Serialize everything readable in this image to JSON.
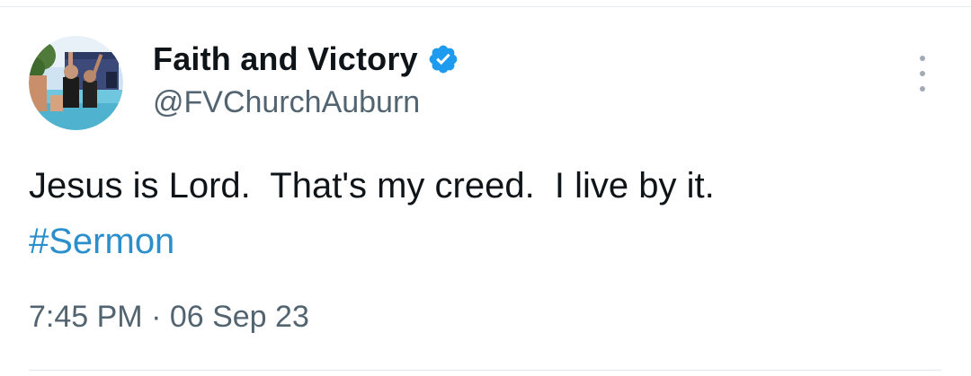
{
  "author": {
    "display_name": "Faith and Victory",
    "handle": "@FVChurchAuburn",
    "verified": true,
    "verified_icon": "verified-badge-icon",
    "verified_color": "#1d9bf0"
  },
  "tweet": {
    "text": "Jesus is Lord.  That's my creed.  I live by it.",
    "hashtag": "#Sermon",
    "timestamp": "7:45 PM · 06 Sep 23"
  },
  "menu": {
    "icon": "more-vertical-icon"
  },
  "colors": {
    "text_primary": "#0f1419",
    "text_secondary": "#536471",
    "link": "#2b8fcb"
  }
}
